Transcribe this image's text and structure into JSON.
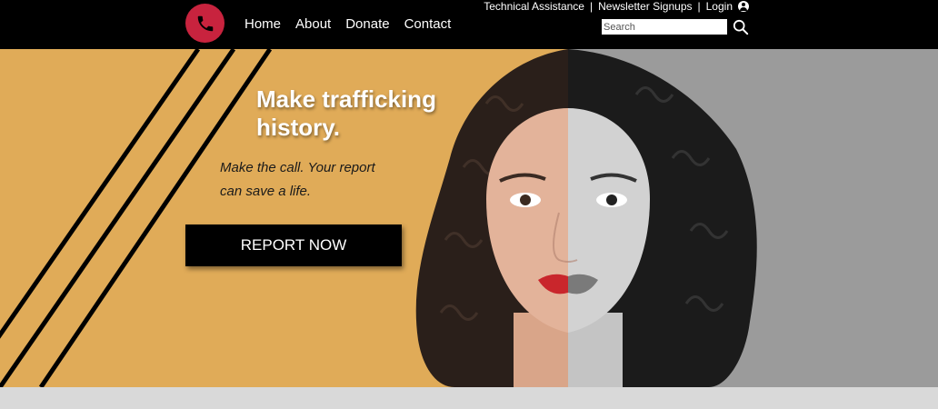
{
  "utility_nav": {
    "technical_assistance": "Technical Assistance",
    "newsletter_signups": "Newsletter Signups",
    "login": "Login",
    "separator": "|"
  },
  "logo": {
    "icon": "phone-icon",
    "color": "#c8233e"
  },
  "main_nav": {
    "items": [
      {
        "label": "Home"
      },
      {
        "label": "About"
      },
      {
        "label": "Donate"
      },
      {
        "label": "Contact"
      }
    ]
  },
  "search": {
    "placeholder": "Search",
    "icon": "search-icon"
  },
  "hero": {
    "headline_line1": "Make trafficking",
    "headline_line2": "history.",
    "subtext_line1": "Make the call. Your report",
    "subtext_line2": "can save a life.",
    "cta_label": "REPORT NOW",
    "colors": {
      "accent": "#e0ab58",
      "gray": "#9b9b9b",
      "dark": "#000000",
      "brand_red": "#c8233e"
    }
  }
}
